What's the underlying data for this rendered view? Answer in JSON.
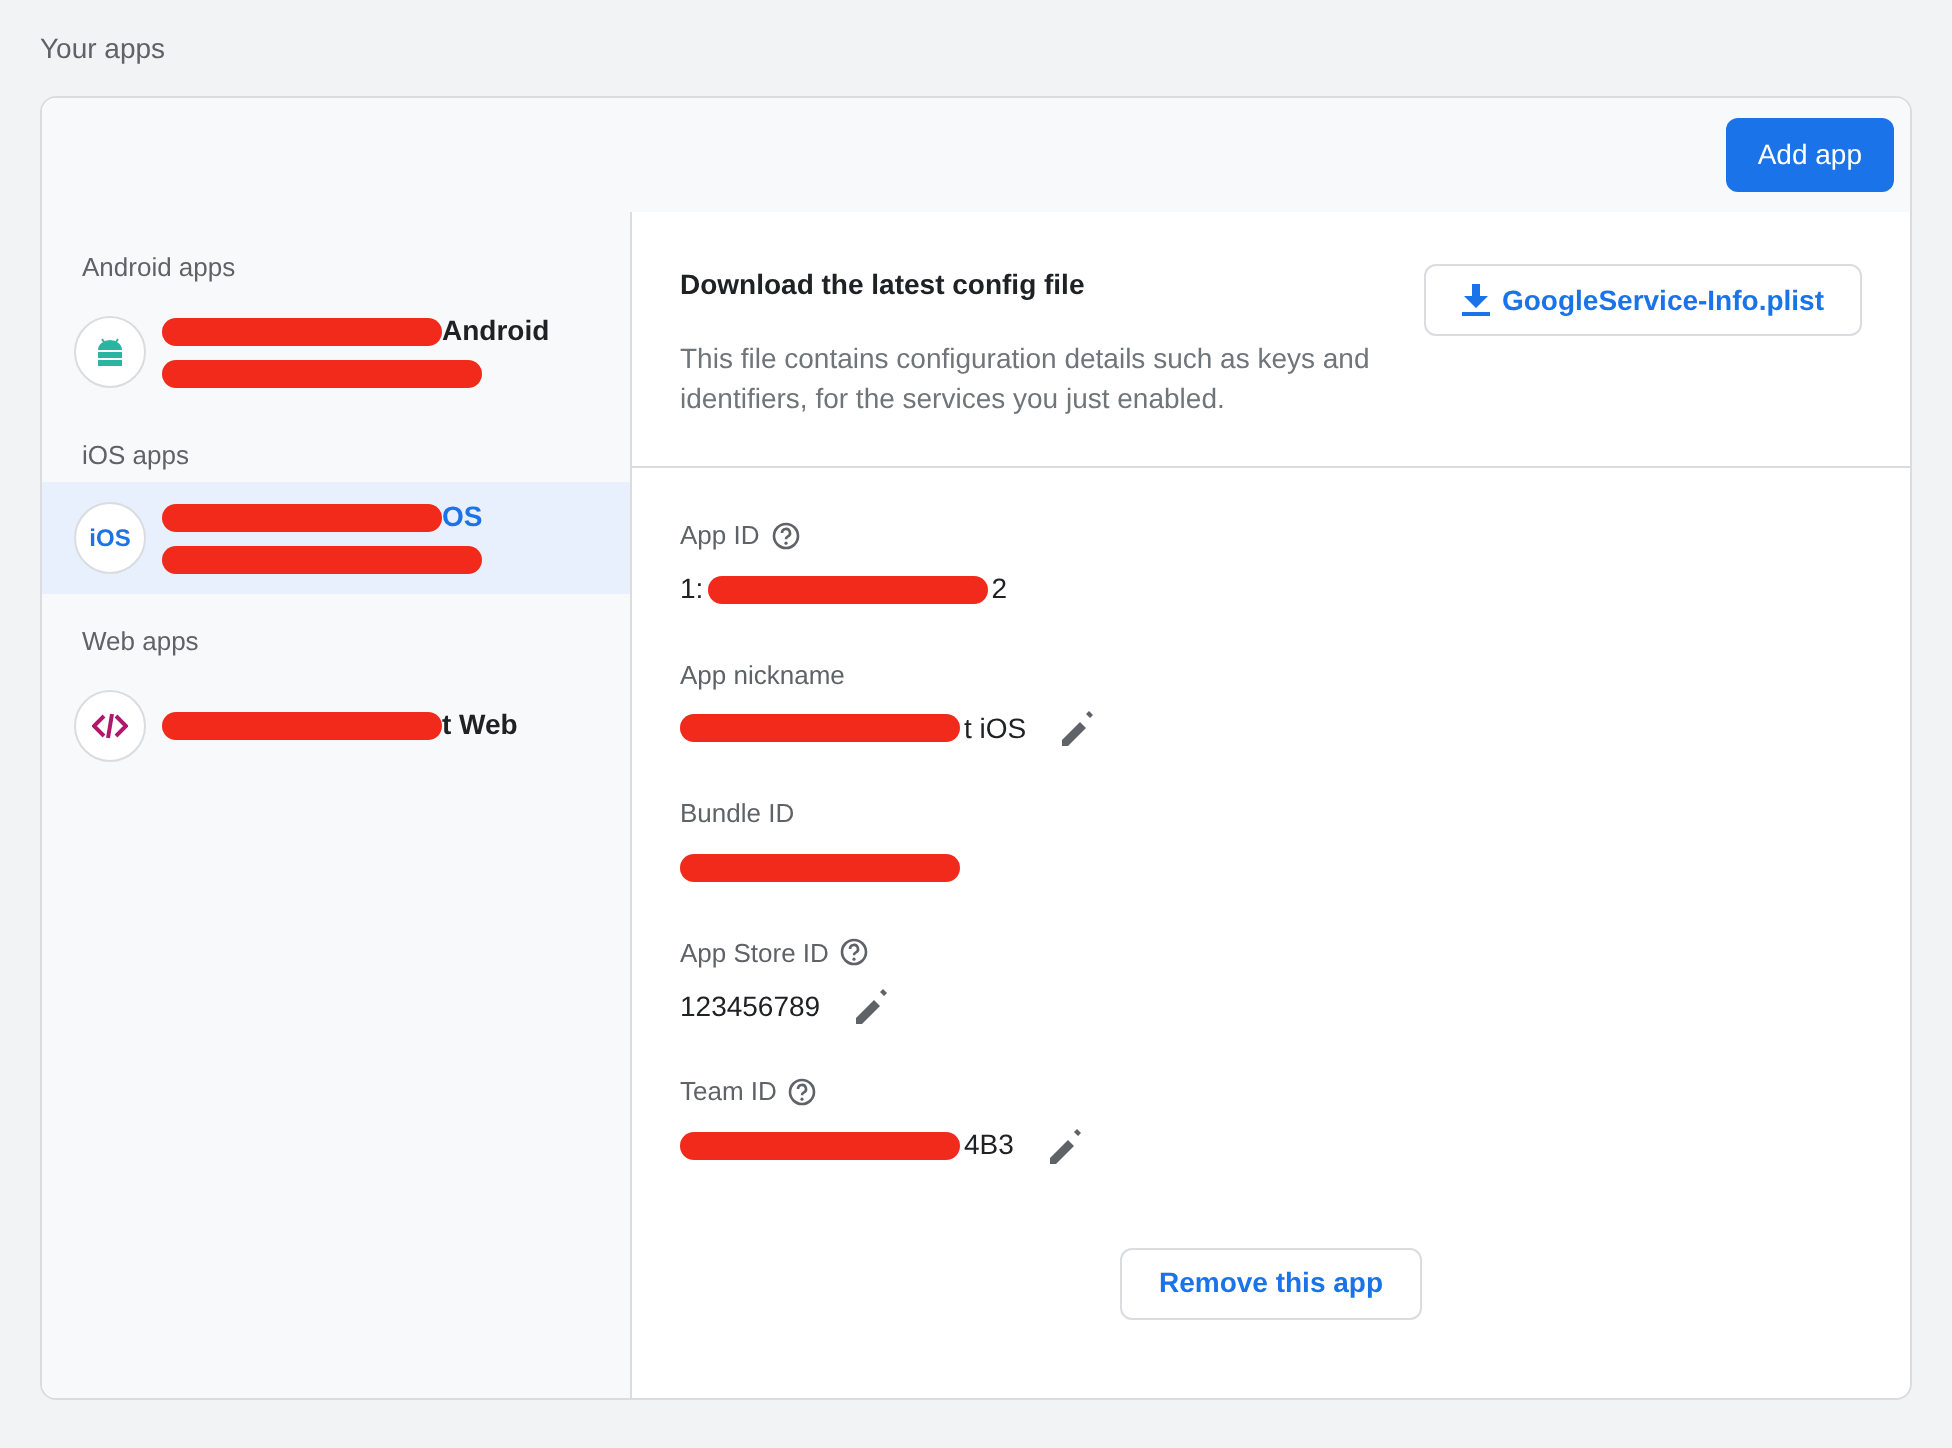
{
  "page_title": "Your apps",
  "add_button": "Add app",
  "sidebar": [
    {
      "heading": "Android apps",
      "apps": [
        {
          "kind": "android",
          "selected": false,
          "title": [
            {
              "kind": "redacted"
            },
            {
              "kind": "text",
              "text": "Android"
            }
          ],
          "subtitle": [
            {
              "kind": "redacted"
            }
          ]
        }
      ]
    },
    {
      "heading": "iOS apps",
      "apps": [
        {
          "kind": "ios",
          "icon_text": "iOS",
          "selected": true,
          "title": [
            {
              "kind": "redacted"
            },
            {
              "kind": "text",
              "text": "OS"
            }
          ],
          "subtitle": [
            {
              "kind": "redacted"
            }
          ]
        }
      ]
    },
    {
      "heading": "Web apps",
      "apps": [
        {
          "kind": "web",
          "selected": false,
          "title": [
            {
              "kind": "redacted"
            },
            {
              "kind": "text",
              "text": "t Web"
            }
          ]
        }
      ]
    }
  ],
  "config": {
    "title": "Download the latest config file",
    "description": "This file contains configuration details such as keys and identifiers, for the services you just enabled.",
    "download_button": "GoogleService-Info.plist"
  },
  "fields": [
    {
      "label": "App ID",
      "help": true,
      "editable": false,
      "value": [
        {
          "kind": "text",
          "text": "1:"
        },
        {
          "kind": "redacted"
        },
        {
          "kind": "text",
          "text": "2"
        }
      ]
    },
    {
      "label": "App nickname",
      "help": false,
      "editable": true,
      "value": [
        {
          "kind": "redacted"
        },
        {
          "kind": "text",
          "text": "t iOS"
        }
      ]
    },
    {
      "label": "Bundle ID",
      "help": false,
      "editable": false,
      "value": [
        {
          "kind": "redacted"
        }
      ]
    },
    {
      "label": "App Store ID",
      "help": true,
      "editable": true,
      "value": [
        {
          "kind": "text",
          "text": "123456789"
        }
      ]
    },
    {
      "label": "Team ID",
      "help": true,
      "editable": true,
      "value": [
        {
          "kind": "redacted"
        },
        {
          "kind": "text",
          "text": "4B3"
        }
      ]
    }
  ],
  "remove_button": "Remove this app"
}
